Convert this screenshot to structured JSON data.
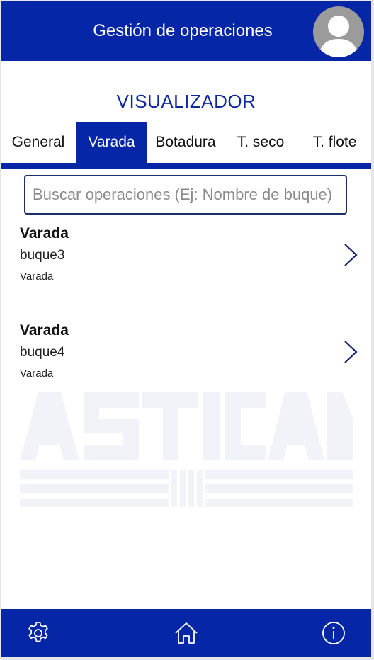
{
  "header": {
    "title": "Gestión de operaciones"
  },
  "section_title": "VISUALIZADOR",
  "tabs": [
    {
      "label": "General",
      "active": false
    },
    {
      "label": "Varada",
      "active": true
    },
    {
      "label": "Botadura",
      "active": false
    },
    {
      "label": "T. seco",
      "active": false
    },
    {
      "label": "T. flote",
      "active": false
    }
  ],
  "search": {
    "placeholder": "Buscar operaciones (Ej: Nombre de buque)",
    "value": ""
  },
  "operations": [
    {
      "title": "Varada",
      "ship": "buque3",
      "status": "Varada"
    },
    {
      "title": "Varada",
      "ship": "buque4",
      "status": "Varada"
    }
  ],
  "watermark": {
    "text": "ASTICAN"
  },
  "footer": {
    "icons": [
      "gear-icon",
      "home-icon",
      "info-icon"
    ]
  },
  "colors": {
    "primary": "#0526a6",
    "accent_text": "#0d28a0",
    "background": "#ffffff"
  }
}
